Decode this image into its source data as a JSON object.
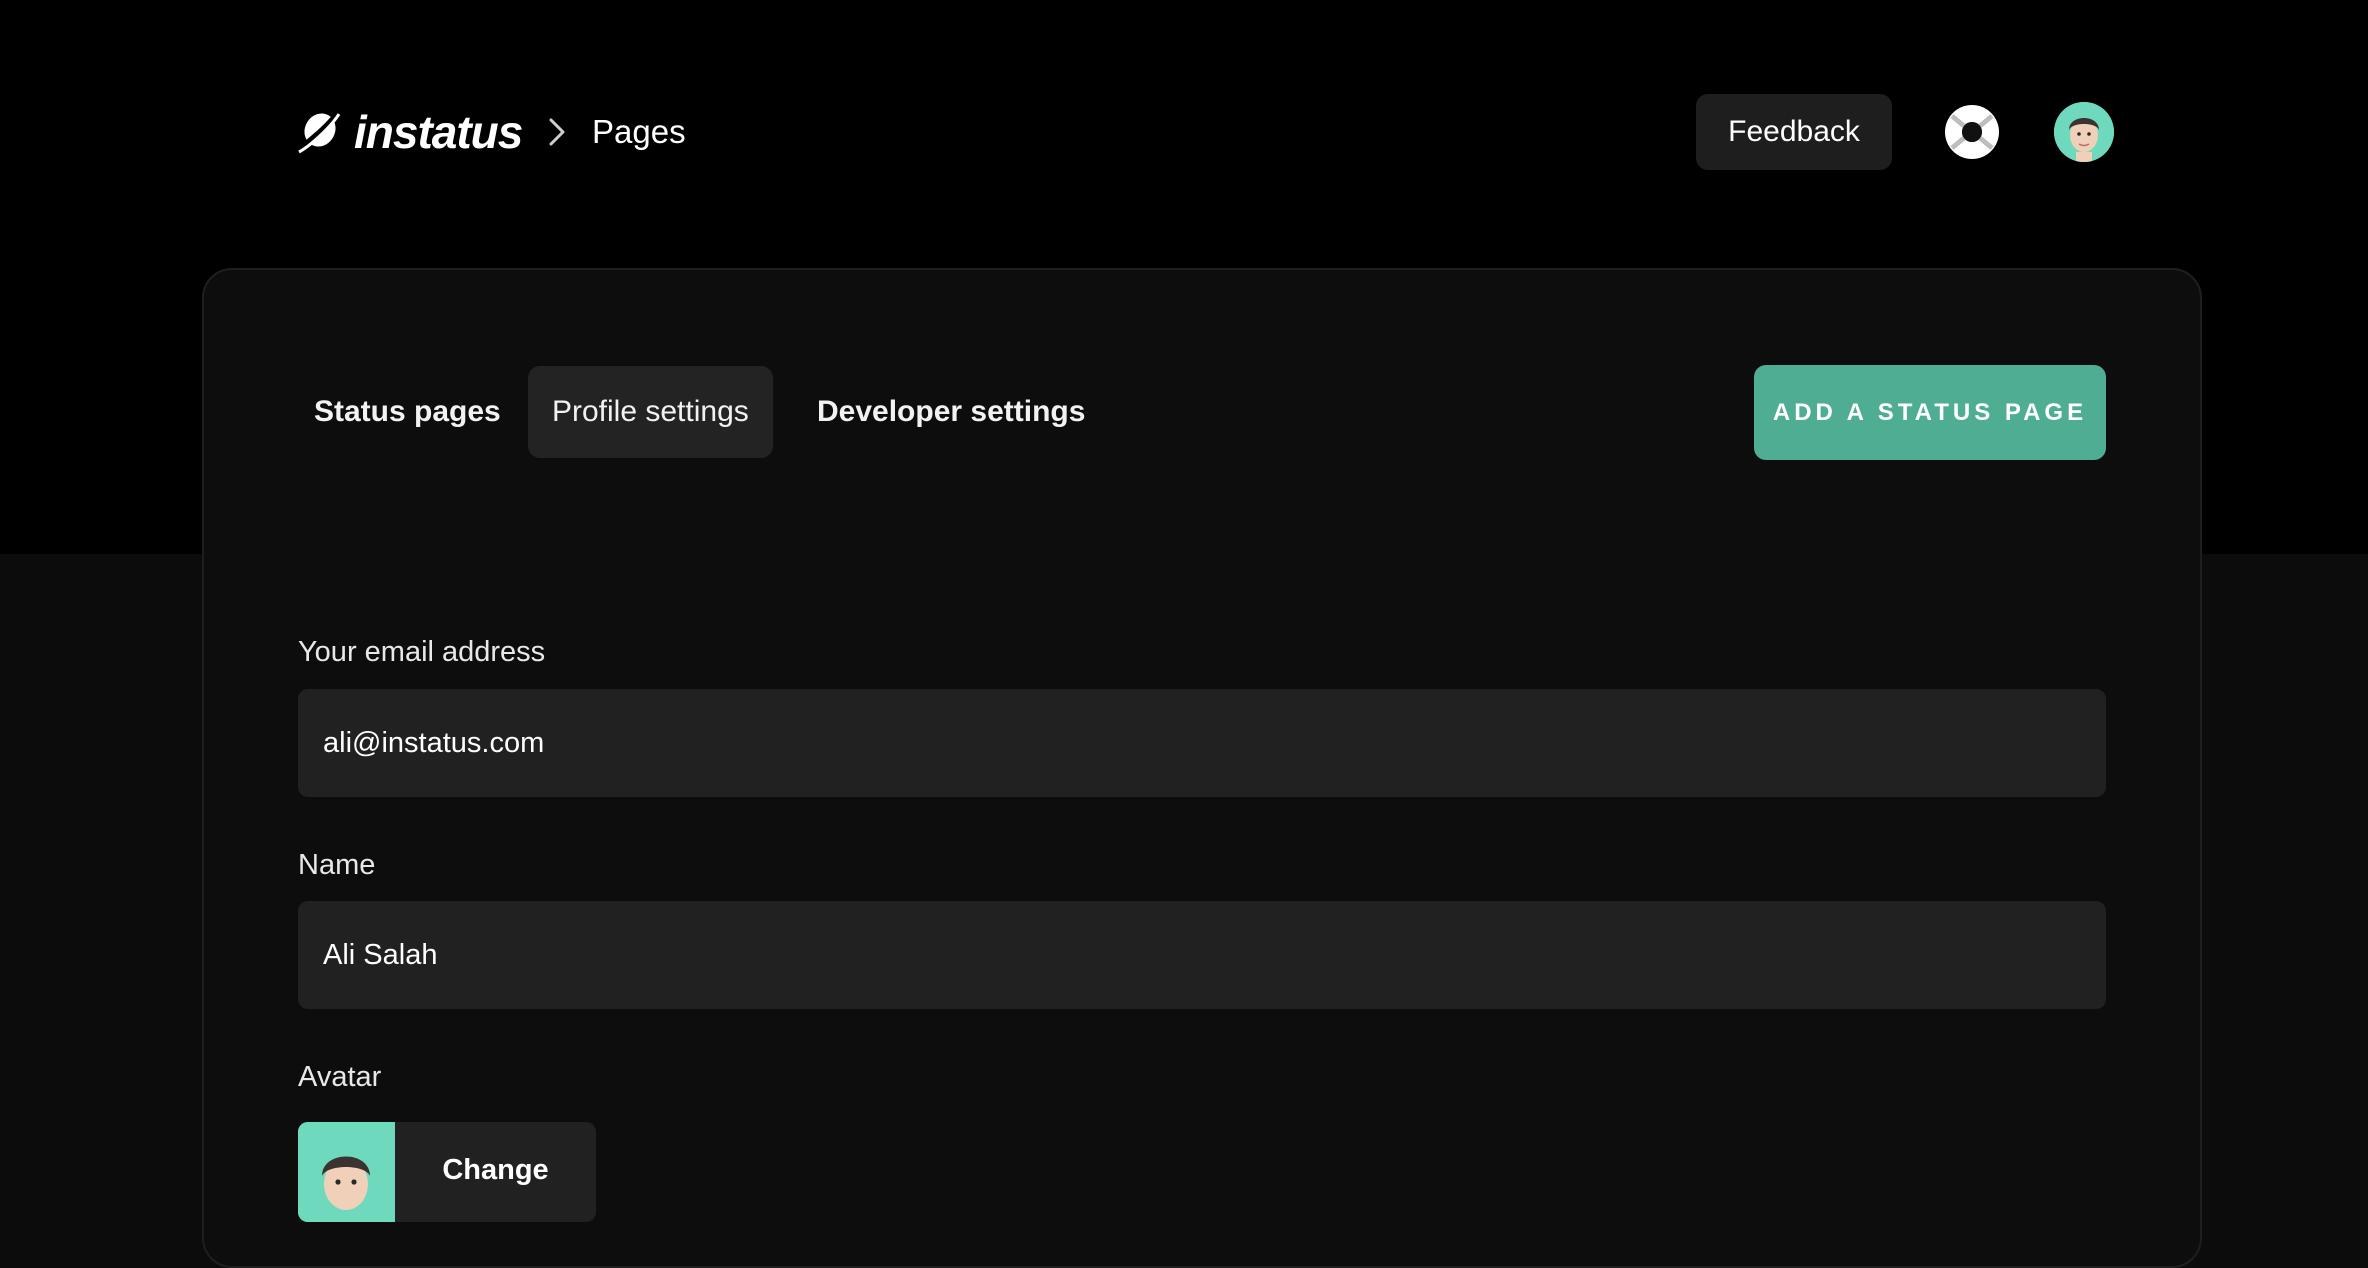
{
  "header": {
    "brand": "instatus",
    "breadcrumb_current": "Pages",
    "feedback_label": "Feedback"
  },
  "tabs": [
    {
      "label": "Status pages",
      "active": false
    },
    {
      "label": "Profile settings",
      "active": true
    },
    {
      "label": "Developer settings",
      "active": false
    }
  ],
  "actions": {
    "add_status_page_label": "ADD A STATUS PAGE"
  },
  "form": {
    "email": {
      "label": "Your email address",
      "value": "ali@instatus.com"
    },
    "name": {
      "label": "Name",
      "value": "Ali Salah"
    },
    "avatar": {
      "label": "Avatar",
      "change_label": "Change"
    }
  },
  "colors": {
    "accent": "#4fad93",
    "avatar_bg": "#6fd9bd",
    "surface": "#212121",
    "page_bg": "#000000"
  },
  "icons": {
    "logo": "planet-logo-icon",
    "breadcrumb_separator": "chevron-right-icon",
    "help": "lifebuoy-icon",
    "user": "memoji-avatar-icon"
  }
}
